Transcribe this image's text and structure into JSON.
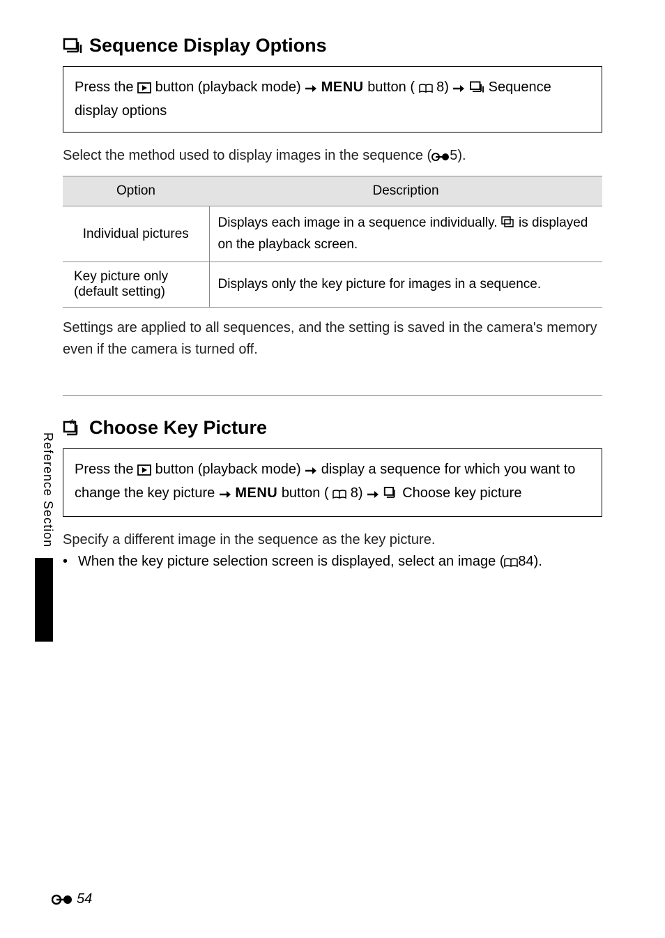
{
  "section1": {
    "title": "Sequence Display Options",
    "instruction": {
      "t1": "Press the ",
      "t2": " button (playback mode) ",
      "t3": " ",
      "menuWord": "MENU",
      "t4": " button (",
      "t5": "8) ",
      "t6": " ",
      "t7": " Sequence display options"
    },
    "intro_a": "Select the method used to display images in the sequence (",
    "intro_b": "5).",
    "table": {
      "head_option": "Option",
      "head_desc": "Description",
      "row1": {
        "option": "Individual pictures",
        "desc_a": "Displays each image in a sequence individually. ",
        "desc_b": " is displayed on the playback screen."
      },
      "row2": {
        "option_a": "Key picture only",
        "option_b": "(default setting)",
        "desc": "Displays only the key picture for images in a sequence."
      }
    },
    "after": "Settings are applied to all sequences, and the setting is saved in the camera's memory even if the camera is turned off."
  },
  "section2": {
    "title": "Choose Key Picture",
    "instruction": {
      "t1": "Press the ",
      "t2": " button (playback mode) ",
      "t3": " display a sequence for which you want to change the key picture ",
      "t4": " ",
      "menuWord": "MENU",
      "t5": " button (",
      "t6": "8) ",
      "t7": " ",
      "t8": " Choose key picture"
    },
    "p1": "Specify a different image in the sequence as the key picture.",
    "bullet_a": "When the key picture selection screen is displayed, select an image (",
    "bullet_b": "84)."
  },
  "sidebar": "Reference Section",
  "pageNumber": "54"
}
